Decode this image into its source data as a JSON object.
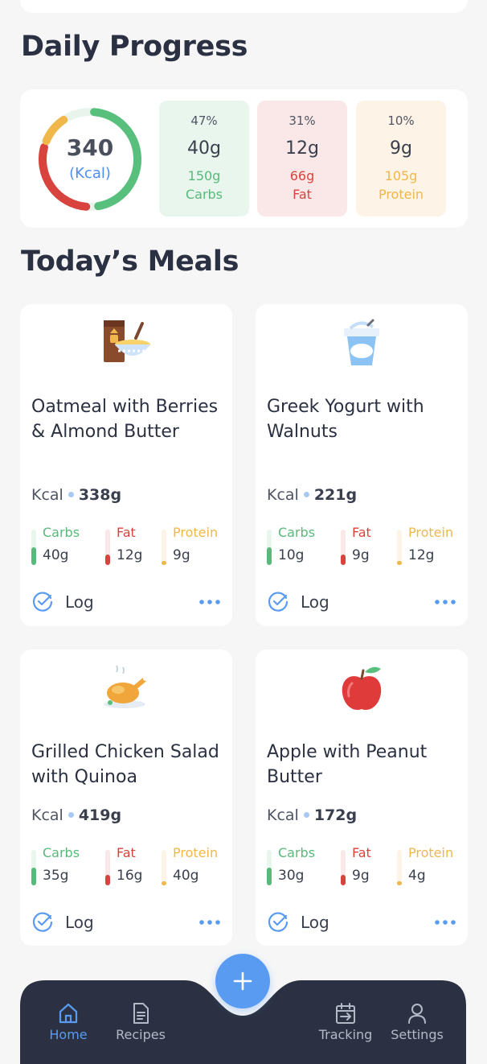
{
  "daily_progress": {
    "title": "Daily Progress",
    "calories_value": "340",
    "calories_unit": "(Kcal)",
    "ring_segments": [
      {
        "name": "carbs",
        "color": "#58c07c",
        "fraction": 0.47
      },
      {
        "name": "fat",
        "color": "#d9433d",
        "fraction": 0.31
      },
      {
        "name": "protein",
        "color": "#f0b74a",
        "fraction": 0.1
      }
    ],
    "macros": [
      {
        "percent": "47%",
        "value": "40g",
        "target": "150g",
        "name": "Carbs",
        "color": "#58b97a",
        "bg": "#e9f6ee"
      },
      {
        "percent": "31%",
        "value": "12g",
        "target": "66g",
        "name": "Fat",
        "color": "#d9433d",
        "bg": "#f9e8e7"
      },
      {
        "percent": "10%",
        "value": "9g",
        "target": "105g",
        "name": "Protein",
        "color": "#f0b74a",
        "bg": "#fdf3e6"
      }
    ]
  },
  "meals_section": {
    "title": "Today’s Meals",
    "meals": [
      {
        "name": "Oatmeal with Berries & Almond Butter",
        "icon": "oatmeal-bowl-icon",
        "kcal_label": "Kcal",
        "kcal_value": "338g",
        "carbs": {
          "label": "Carbs",
          "value": "40g",
          "level": 0.5
        },
        "fat": {
          "label": "Fat",
          "value": "12g",
          "level": 0.3
        },
        "protein": {
          "label": "Protein",
          "value": "9g",
          "level": 0.1
        },
        "log_label": "Log"
      },
      {
        "name": "Greek Yogurt with Walnuts",
        "icon": "yogurt-cup-icon",
        "kcal_label": "Kcal",
        "kcal_value": "221g",
        "carbs": {
          "label": "Carbs",
          "value": "10g",
          "level": 0.5
        },
        "fat": {
          "label": "Fat",
          "value": "9g",
          "level": 0.3
        },
        "protein": {
          "label": "Protein",
          "value": "12g",
          "level": 0.1
        },
        "log_label": "Log"
      },
      {
        "name": "Grilled Chicken Salad with Quinoa",
        "icon": "roast-chicken-icon",
        "kcal_label": "Kcal",
        "kcal_value": "419g",
        "carbs": {
          "label": "Carbs",
          "value": "35g",
          "level": 0.5
        },
        "fat": {
          "label": "Fat",
          "value": "16g",
          "level": 0.3
        },
        "protein": {
          "label": "Protein",
          "value": "40g",
          "level": 0.1
        },
        "log_label": "Log"
      },
      {
        "name": "Apple with Peanut Butter",
        "icon": "apple-icon",
        "kcal_label": "Kcal",
        "kcal_value": "172g",
        "carbs": {
          "label": "Carbs",
          "value": "30g",
          "level": 0.5
        },
        "fat": {
          "label": "Fat",
          "value": "9g",
          "level": 0.3
        },
        "protein": {
          "label": "Protein",
          "value": "4g",
          "level": 0.1
        },
        "log_label": "Log"
      }
    ]
  },
  "nav": {
    "items": [
      {
        "label": "Home",
        "icon": "home-icon",
        "active": true
      },
      {
        "label": "Recipes",
        "icon": "recipes-icon",
        "active": false
      },
      {
        "label": "Tracking",
        "icon": "tracking-icon",
        "active": false
      },
      {
        "label": "Settings",
        "icon": "settings-icon",
        "active": false
      }
    ],
    "fab_icon": "plus-icon"
  },
  "colors": {
    "accent": "#5a9bf2",
    "nav_bg": "#2b3142",
    "carbs": "#58b97a",
    "fat": "#d9433d",
    "protein": "#f0b74a"
  }
}
